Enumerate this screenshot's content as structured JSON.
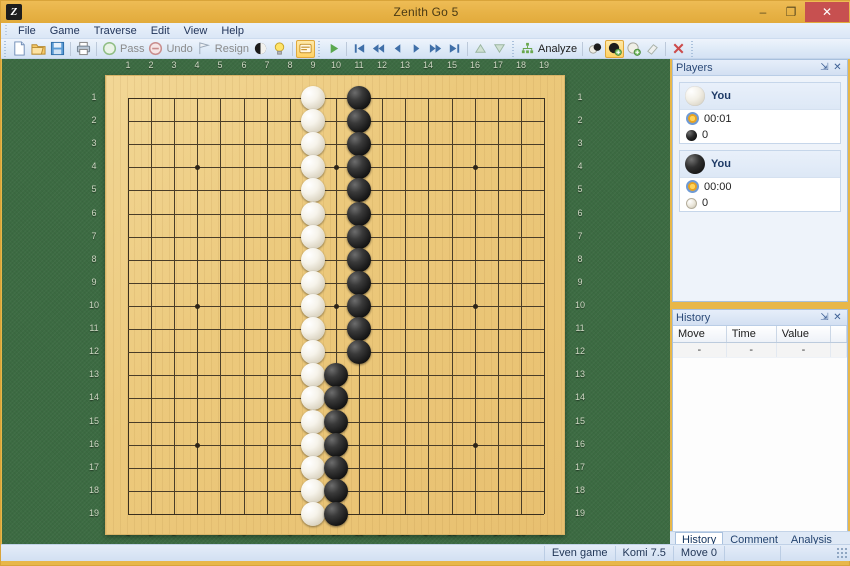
{
  "window": {
    "title": "Zenith Go 5",
    "app_icon": "Z",
    "minimize": "–",
    "maximize": "❐",
    "close": "✕"
  },
  "menu": {
    "items": [
      {
        "label": "File"
      },
      {
        "label": "Game"
      },
      {
        "label": "Traverse"
      },
      {
        "label": "Edit"
      },
      {
        "label": "View"
      },
      {
        "label": "Help"
      }
    ]
  },
  "toolbar": {
    "new_label": "",
    "open_label": "",
    "save_label": "",
    "print_label": "",
    "pass_label": "Pass",
    "undo_label": "Undo",
    "resign_label": "Resign",
    "analyze_label": "Analyze",
    "icons": [
      "new-file-icon",
      "open-folder-icon",
      "save-disk-icon",
      "printer-icon",
      "pass-icon",
      "undo-icon",
      "resign-icon",
      "stone-toggle-icon",
      "hint-bulb-icon",
      "comment-icon",
      "play-icon",
      "first-move-icon",
      "fast-rewind-icon",
      "prev-move-icon",
      "next-move-icon",
      "fast-forward-icon",
      "last-move-icon",
      "up-variation-icon",
      "down-variation-icon",
      "analyze-tree-icon",
      "two-stones-icon",
      "black-stone-place-icon",
      "white-stone-place-icon",
      "eraser-icon",
      "delete-x-icon"
    ]
  },
  "board": {
    "size": 19,
    "column_labels": [
      "1",
      "2",
      "3",
      "4",
      "5",
      "6",
      "7",
      "8",
      "9",
      "10",
      "11",
      "12",
      "13",
      "14",
      "15",
      "16",
      "17",
      "18",
      "19"
    ],
    "row_labels": [
      "1",
      "2",
      "3",
      "4",
      "5",
      "6",
      "7",
      "8",
      "9",
      "10",
      "11",
      "12",
      "13",
      "14",
      "15",
      "16",
      "17",
      "18",
      "19"
    ],
    "star_points": [
      [
        4,
        4
      ],
      [
        10,
        4
      ],
      [
        16,
        4
      ],
      [
        4,
        10
      ],
      [
        10,
        10
      ],
      [
        16,
        10
      ],
      [
        4,
        16
      ],
      [
        10,
        16
      ],
      [
        16,
        16
      ]
    ],
    "stones": [
      {
        "color": "white",
        "col": 9,
        "row": 1
      },
      {
        "color": "white",
        "col": 9,
        "row": 2
      },
      {
        "color": "white",
        "col": 9,
        "row": 3
      },
      {
        "color": "white",
        "col": 9,
        "row": 4
      },
      {
        "color": "white",
        "col": 9,
        "row": 5
      },
      {
        "color": "white",
        "col": 9,
        "row": 6
      },
      {
        "color": "white",
        "col": 9,
        "row": 7
      },
      {
        "color": "white",
        "col": 9,
        "row": 8
      },
      {
        "color": "white",
        "col": 9,
        "row": 9
      },
      {
        "color": "white",
        "col": 9,
        "row": 10
      },
      {
        "color": "white",
        "col": 9,
        "row": 11
      },
      {
        "color": "white",
        "col": 9,
        "row": 12
      },
      {
        "color": "white",
        "col": 9,
        "row": 13
      },
      {
        "color": "white",
        "col": 9,
        "row": 14
      },
      {
        "color": "white",
        "col": 9,
        "row": 15
      },
      {
        "color": "white",
        "col": 9,
        "row": 16
      },
      {
        "color": "white",
        "col": 9,
        "row": 17
      },
      {
        "color": "white",
        "col": 9,
        "row": 18
      },
      {
        "color": "white",
        "col": 9,
        "row": 19
      },
      {
        "color": "black",
        "col": 11,
        "row": 1
      },
      {
        "color": "black",
        "col": 11,
        "row": 2
      },
      {
        "color": "black",
        "col": 11,
        "row": 3
      },
      {
        "color": "black",
        "col": 11,
        "row": 4
      },
      {
        "color": "black",
        "col": 11,
        "row": 5
      },
      {
        "color": "black",
        "col": 11,
        "row": 6
      },
      {
        "color": "black",
        "col": 11,
        "row": 7
      },
      {
        "color": "black",
        "col": 11,
        "row": 8
      },
      {
        "color": "black",
        "col": 11,
        "row": 9
      },
      {
        "color": "black",
        "col": 11,
        "row": 10
      },
      {
        "color": "black",
        "col": 11,
        "row": 11
      },
      {
        "color": "black",
        "col": 11,
        "row": 12
      },
      {
        "color": "black",
        "col": 10,
        "row": 13
      },
      {
        "color": "black",
        "col": 10,
        "row": 14
      },
      {
        "color": "black",
        "col": 10,
        "row": 15
      },
      {
        "color": "black",
        "col": 10,
        "row": 16
      },
      {
        "color": "black",
        "col": 10,
        "row": 17
      },
      {
        "color": "black",
        "col": 10,
        "row": 18
      },
      {
        "color": "black",
        "col": 10,
        "row": 19
      }
    ]
  },
  "players_panel": {
    "title": "Players",
    "pin": "⇲",
    "close": "✕",
    "players": [
      {
        "color": "white",
        "name": "You",
        "time": "00:01",
        "captures": "0",
        "capture_stone": "black"
      },
      {
        "color": "black",
        "name": "You",
        "time": "00:00",
        "captures": "0",
        "capture_stone": "white"
      }
    ]
  },
  "history_panel": {
    "title": "History",
    "pin": "⇲",
    "close": "✕",
    "columns": [
      "Move",
      "Time",
      "Value",
      ""
    ],
    "rows": [
      [
        "-",
        "-",
        "-",
        ""
      ]
    ]
  },
  "dock_tabs": [
    {
      "label": "History",
      "selected": true
    },
    {
      "label": "Comment",
      "selected": false
    },
    {
      "label": "Analysis",
      "selected": false
    }
  ],
  "statusbar": {
    "game_type": "Even game",
    "komi": "Komi 7.5",
    "move": "Move 0"
  }
}
